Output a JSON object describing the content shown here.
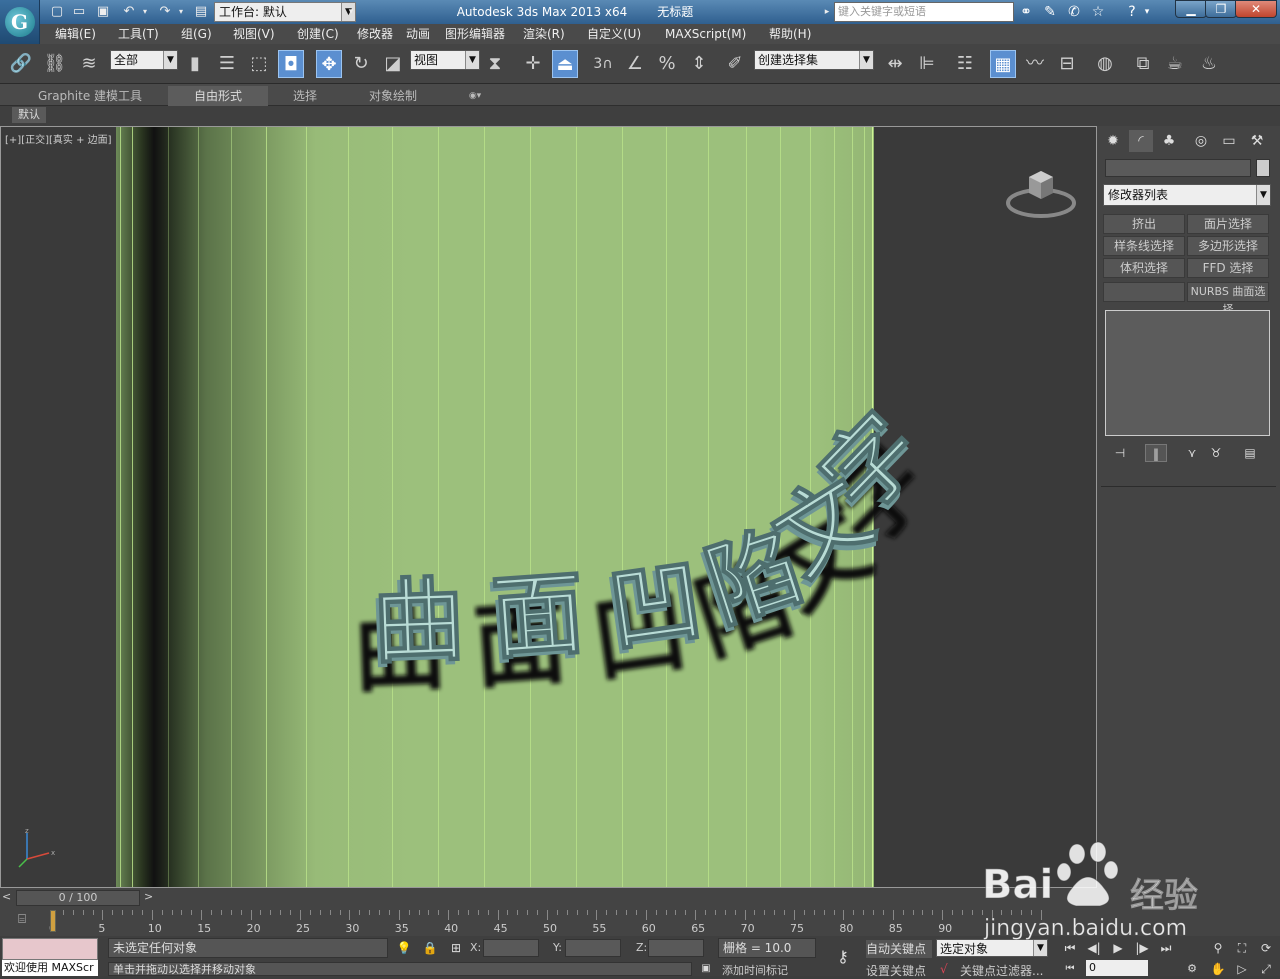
{
  "titlebar": {
    "app_name": "Autodesk 3ds Max  2013 x64",
    "doc_name": "无标题",
    "workspace_label": "工作台: 默认",
    "search_placeholder": "键入关键字或短语"
  },
  "menu": [
    "编辑(E)",
    "工具(T)",
    "组(G)",
    "视图(V)",
    "创建(C)",
    "修改器",
    "动画",
    "图形编辑器",
    "渲染(R)",
    "自定义(U)",
    "MAXScript(M)",
    "帮助(H)"
  ],
  "toolbar": {
    "filter_value": "全部",
    "refcoord_value": "视图",
    "selset_placeholder": "创建选择集",
    "snap_label": "3"
  },
  "ribbon": {
    "tabs": [
      "Graphite 建模工具",
      "自由形式",
      "选择",
      "对象绘制"
    ],
    "active": "自由形式",
    "default_label": "默认"
  },
  "viewport": {
    "label_plus": "[+]",
    "label_view": "[正交]",
    "label_shade": "[真实 + 边面]",
    "text3d": "曲面凹陷文字",
    "wall_color": "#9cc07c"
  },
  "cmdpanel": {
    "modifier_list": "修改器列表",
    "buttons": [
      "挤出",
      "面片选择",
      "样条线选择",
      "多边形选择",
      "体积选择",
      "FFD 选择",
      "",
      "NURBS 曲面选择"
    ]
  },
  "timeline": {
    "slider_text": "0 / 100",
    "ticks": [
      0,
      5,
      10,
      15,
      20,
      25,
      30,
      35,
      40,
      45,
      50,
      55,
      60,
      65,
      70,
      75,
      80,
      85,
      90
    ]
  },
  "status": {
    "welcome": "欢迎使用 MAXScr",
    "selection": "未选定任何对象",
    "prompt": "单击并拖动以选择并移动对象",
    "x_label": "X:",
    "y_label": "Y:",
    "z_label": "Z:",
    "grid": "栅格 = 10.0",
    "add_time_tag": "添加时间标记",
    "auto_key": "自动关键点",
    "set_key": "设置关键点",
    "key_mode": "选定对象",
    "key_filter": "关键点过滤器...",
    "frame": "0"
  },
  "watermark": {
    "brand": "Bai",
    "brand2": "经验",
    "url": "jingyan.baidu.com"
  }
}
